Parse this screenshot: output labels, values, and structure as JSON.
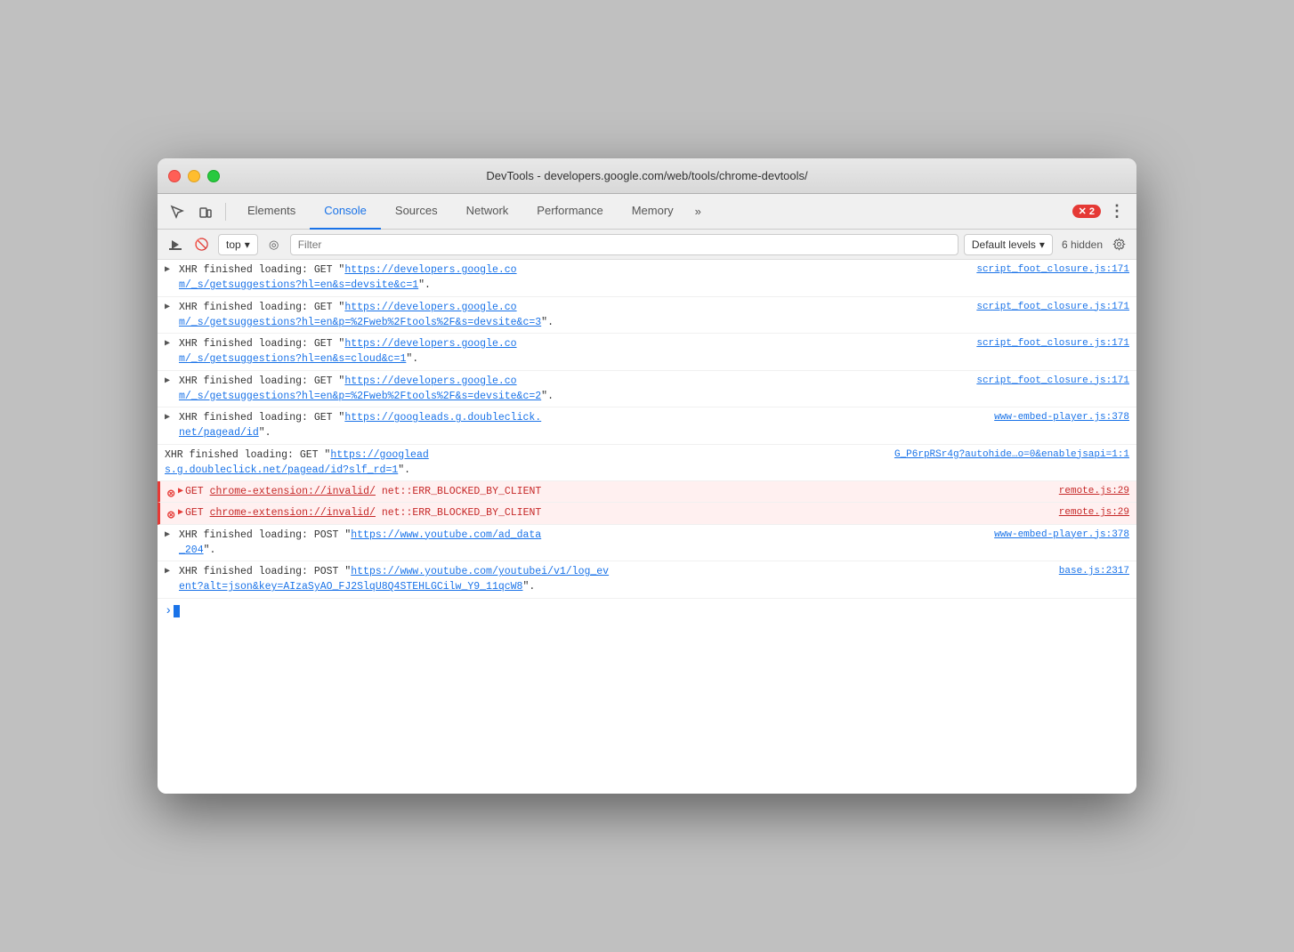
{
  "window": {
    "title": "DevTools - developers.google.com/web/tools/chrome-devtools/"
  },
  "tabs": {
    "items": [
      {
        "id": "elements",
        "label": "Elements"
      },
      {
        "id": "console",
        "label": "Console"
      },
      {
        "id": "sources",
        "label": "Sources"
      },
      {
        "id": "network",
        "label": "Network"
      },
      {
        "id": "performance",
        "label": "Performance"
      },
      {
        "id": "memory",
        "label": "Memory"
      }
    ],
    "active": "console",
    "more_label": "»"
  },
  "toolbar": {
    "error_count": "2",
    "error_badge_x": "✕"
  },
  "console_toolbar": {
    "context": "top",
    "context_arrow": "▾",
    "filter_placeholder": "Filter",
    "levels_label": "Default levels",
    "levels_arrow": "▾",
    "hidden_label": "6 hidden"
  },
  "log_entries": [
    {
      "id": "xhr1",
      "type": "info",
      "has_arrow": true,
      "content_line1": "XHR finished loading: GET \"https://developers.google.co",
      "content_line2": "m/_s/getsuggestions?hl=en&s=devsite&c=1\".",
      "source": "script_foot_closure.js:171"
    },
    {
      "id": "xhr2",
      "type": "info",
      "has_arrow": true,
      "content_line1": "XHR finished loading: GET \"https://developers.google.co",
      "content_line2": "m/_s/getsuggestions?hl=en&p=%2Fweb%2Ftools%2F&s=devsite&c=3\".",
      "source": "script_foot_closure.js:171"
    },
    {
      "id": "xhr3",
      "type": "info",
      "has_arrow": true,
      "content_line1": "XHR finished loading: GET \"https://developers.google.co",
      "content_line2": "m/_s/getsuggestions?hl=en&s=cloud&c=1\".",
      "source": "script_foot_closure.js:171"
    },
    {
      "id": "xhr4",
      "type": "info",
      "has_arrow": true,
      "content_line1": "XHR finished loading: GET \"https://developers.google.co",
      "content_line2": "m/_s/getsuggestions?hl=en&p=%2Fweb%2Ftools%2F&s=devsite&c=2\".",
      "source": "script_foot_closure.js:171"
    },
    {
      "id": "xhr5",
      "type": "info",
      "has_arrow": true,
      "content_line1": "XHR finished loading: GET \"https://googleads.g.doubleclick.",
      "content_line2": "net/pagead/id\".",
      "source": "www-embed-player.js:378"
    },
    {
      "id": "xhr6",
      "type": "info",
      "has_arrow": false,
      "content_line1": "XHR finished loading: GET \"https://googlead",
      "content_line2": "s.g.doubleclick.net/pagead/id?slf_rd=1\".",
      "source": "G_P6rpRSr4g?autohide…o=0&enablejsapi=1:1"
    },
    {
      "id": "err1",
      "type": "error",
      "has_arrow": true,
      "content_line1": "GET chrome-extension://invalid/",
      "content_line2": "net::ERR_BLOCKED_BY_CLIENT",
      "source": "remote.js:29"
    },
    {
      "id": "err2",
      "type": "error",
      "has_arrow": true,
      "content_line1": "GET chrome-extension://invalid/",
      "content_line2": "net::ERR_BLOCKED_BY_CLIENT",
      "source": "remote.js:29"
    },
    {
      "id": "xhr7",
      "type": "info",
      "has_arrow": true,
      "content_line1": "XHR finished loading: POST \"https://www.youtube.com/ad_data",
      "content_line2": "_204\".",
      "source": "www-embed-player.js:378"
    },
    {
      "id": "xhr8",
      "type": "info",
      "has_arrow": true,
      "content_line1": "XHR finished loading: POST \"https://www.youtube.com/youtubei/v1/log_ev",
      "content_line2": "ent?alt=json&key=AIzaSyAO_FJ2SlqU8Q4STEHLGCilw_Y9_11qcW8\".",
      "source": "base.js:2317"
    }
  ]
}
